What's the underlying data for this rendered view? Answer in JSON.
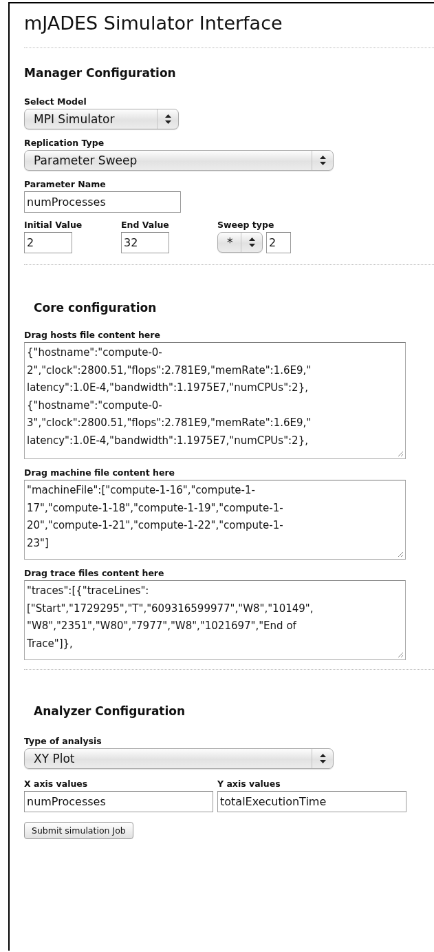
{
  "title": "mJADES Simulator Interface",
  "manager": {
    "heading": "Manager Configuration",
    "select_model": {
      "label": "Select Model",
      "value": "MPI Simulator"
    },
    "replication_type": {
      "label": "Replication Type",
      "value": "Parameter Sweep"
    },
    "parameter_name": {
      "label": "Parameter Name",
      "value": "numProcesses"
    },
    "initial_value": {
      "label": "Initial Value",
      "value": "2"
    },
    "end_value": {
      "label": "End Value",
      "value": "32"
    },
    "sweep_type": {
      "label": "Sweep type",
      "operator": "*",
      "step": "2"
    }
  },
  "core": {
    "heading": "Core configuration",
    "fields": [
      {
        "label": "Drag hosts file content here",
        "lines": [
          "{\"hostname\":\"compute-0-",
          "2\",\"clock\":2800.51,\"flops\":2.781E9,\"memRate\":1.6E9,\"",
          "latency\":1.0E-4,\"bandwidth\":1.1975E7,\"numCPUs\":2},",
          "{\"hostname\":\"compute-0-",
          "3\",\"clock\":2800.51,\"flops\":2.781E9,\"memRate\":1.6E9,\"",
          "latency\":1.0E-4,\"bandwidth\":1.1975E7,\"numCPUs\":2},"
        ]
      },
      {
        "label": "Drag machine file content here",
        "lines": [
          "\"machineFile\":[\"compute-1-16\",\"compute-1-",
          "17\",\"compute-1-18\",\"compute-1-19\",\"compute-1-",
          "20\",\"compute-1-21\",\"compute-1-22\",\"compute-1-",
          "23\"]"
        ]
      },
      {
        "label": "Drag trace files content here",
        "lines": [
          "\"traces\":[{\"traceLines\":",
          "[\"Start\",\"1729295\",\"T\",\"609316599977\",\"W8\",\"10149\",",
          "\"W8\",\"2351\",\"W80\",\"7977\",\"W8\",\"1021697\",\"End of",
          "Trace\"]},"
        ]
      }
    ]
  },
  "analyzer": {
    "heading": "Analyzer Configuration",
    "type_of_analysis": {
      "label": "Type of analysis",
      "value": "XY Plot"
    },
    "x_axis": {
      "label": "X axis values",
      "value": "numProcesses"
    },
    "y_axis": {
      "label": "Y axis values",
      "value": "totalExecutionTime"
    },
    "submit_button": "Submit simulation Job"
  }
}
